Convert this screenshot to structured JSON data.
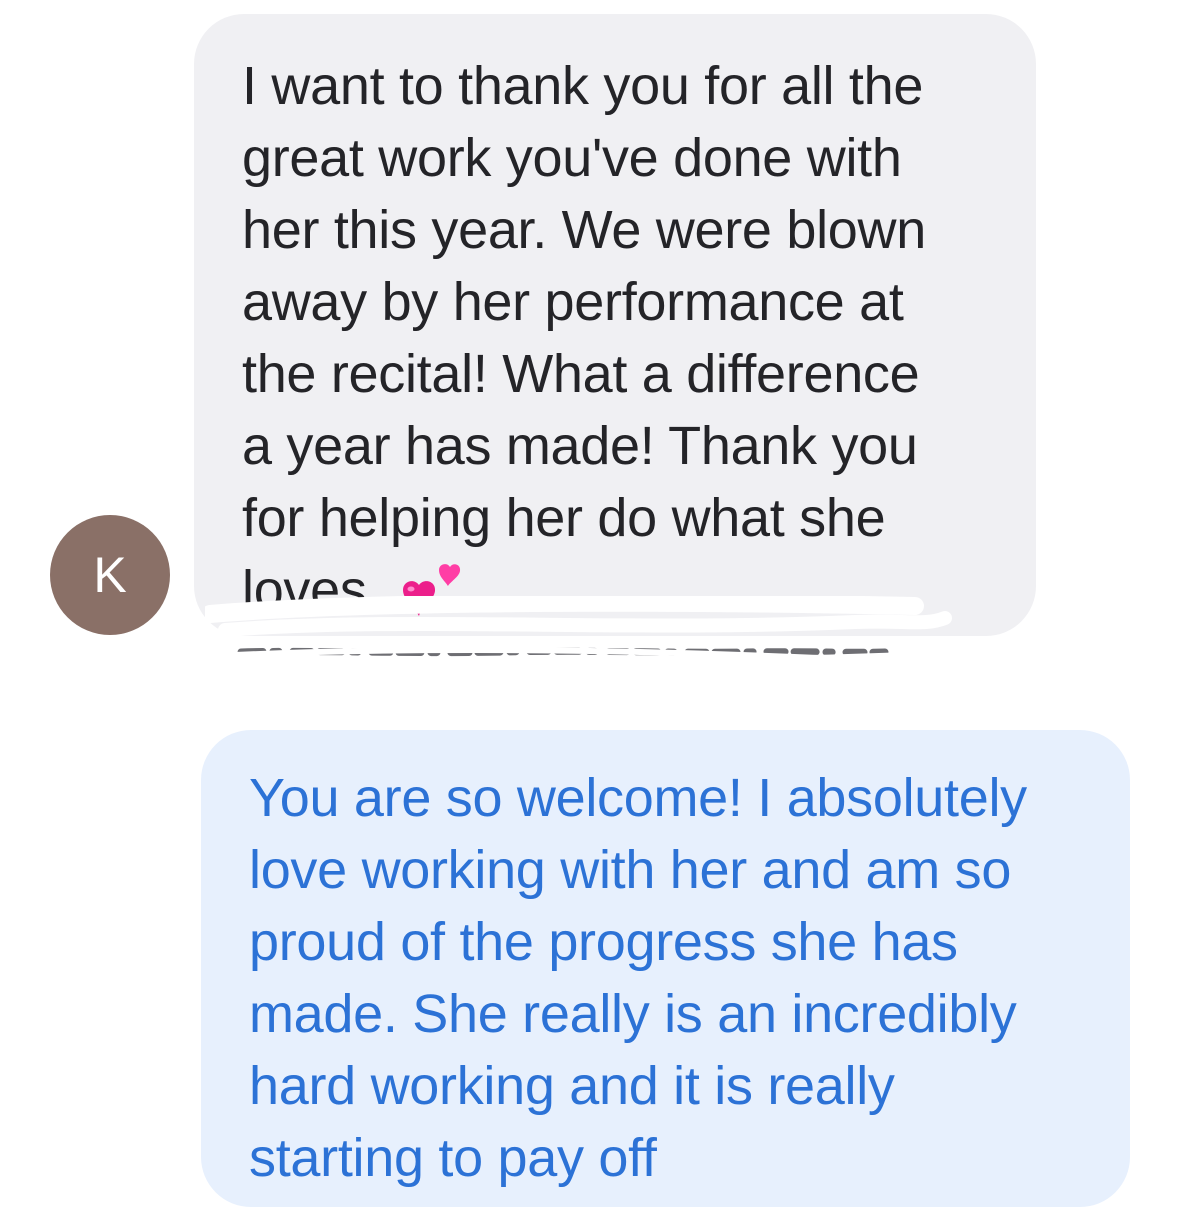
{
  "conversation": {
    "contact": {
      "initial": "K",
      "avatar_color": "#8a7067"
    },
    "messages": [
      {
        "direction": "received",
        "text": "I want to thank you for all the\ngreat work you've done with\nher this year. We were blown\naway by her performance at\nthe recital! What a difference\na year has made! Thank you\nfor helping her do what she\nloves.",
        "emoji": "two-hearts-icon",
        "bubble_color": "#f0f0f3",
        "text_color": "#242428"
      },
      {
        "direction": "sent",
        "text": "You are so welcome! I absolutely\nlove working with her and am so\nproud of the progress she has\nmade. She really is an incredibly\nhard working and it is really\nstarting to pay off",
        "bubble_color": "#e7f0fd",
        "text_color": "#2c72d6"
      }
    ]
  }
}
